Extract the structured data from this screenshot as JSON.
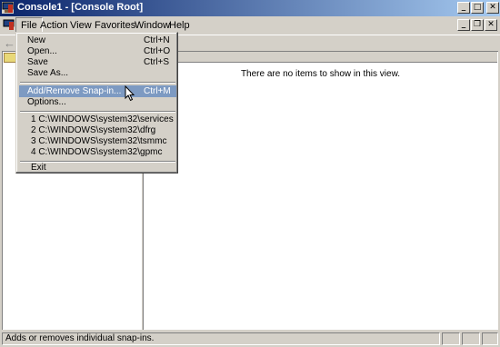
{
  "window": {
    "title": "Console1 - [Console Root]",
    "buttons": {
      "minimize": "_",
      "maximize": "□",
      "close": "✕"
    }
  },
  "menubar": {
    "items": [
      "File",
      "Action",
      "View",
      "Favorites",
      "Window",
      "Help"
    ],
    "child_buttons": {
      "minimize": "_",
      "restore": "❐",
      "close": "✕"
    }
  },
  "file_menu": {
    "new": {
      "label": "New",
      "shortcut": "Ctrl+N"
    },
    "open": {
      "label": "Open...",
      "shortcut": "Ctrl+O"
    },
    "save": {
      "label": "Save",
      "shortcut": "Ctrl+S"
    },
    "save_as": {
      "label": "Save As..."
    },
    "add_remove": {
      "label": "Add/Remove Snap-in...",
      "shortcut": "Ctrl+M"
    },
    "options": {
      "label": "Options..."
    },
    "recent": [
      "1 C:\\WINDOWS\\system32\\services",
      "2 C:\\WINDOWS\\system32\\dfrg",
      "3 C:\\WINDOWS\\system32\\tsmmc",
      "4 C:\\WINDOWS\\system32\\gpmc"
    ],
    "exit": {
      "label": "Exit"
    }
  },
  "main": {
    "empty_message": "There are no items to show in this view."
  },
  "statusbar": {
    "text": "Adds or removes individual snap-ins."
  },
  "colors": {
    "title_gradient_start": "#0a246a",
    "title_gradient_end": "#a6caf0",
    "menu_highlight": "#7d9ac2",
    "chrome": "#d4d0c8"
  }
}
